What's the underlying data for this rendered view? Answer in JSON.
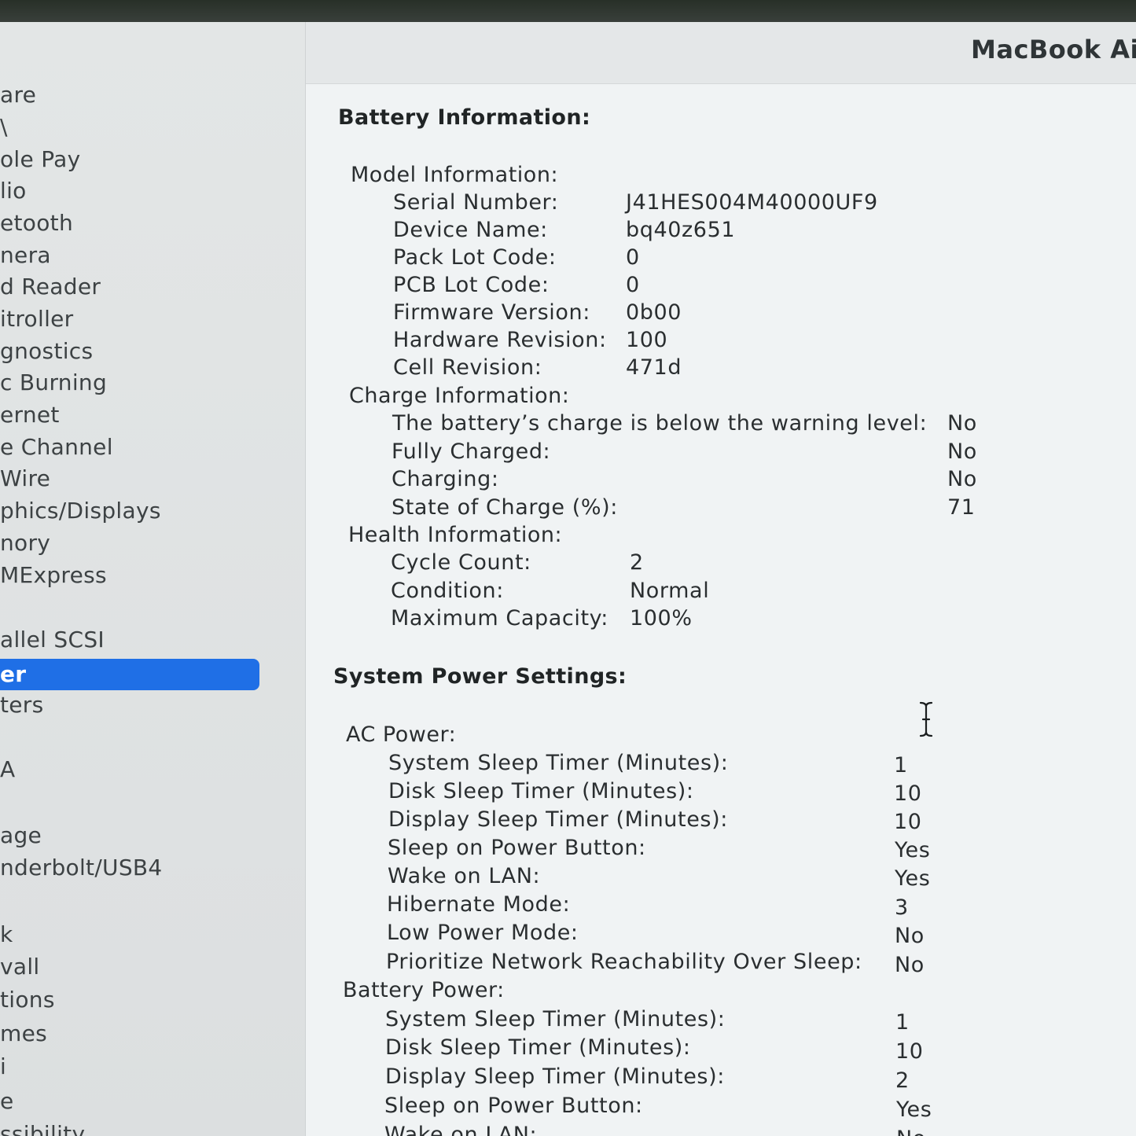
{
  "window": {
    "title": "MacBook Ai"
  },
  "sidebar": {
    "items": [
      {
        "label": "are"
      },
      {
        "label": "\\"
      },
      {
        "label": "ole Pay"
      },
      {
        "label": "lio"
      },
      {
        "label": "etooth"
      },
      {
        "label": "nera"
      },
      {
        "label": "d Reader"
      },
      {
        "label": "itroller"
      },
      {
        "label": "gnostics"
      },
      {
        "label": "c Burning"
      },
      {
        "label": "ernet"
      },
      {
        "label": "e Channel"
      },
      {
        "label": "Wire"
      },
      {
        "label": "phics/Displays"
      },
      {
        "label": "nory"
      },
      {
        "label": "MExpress"
      },
      {
        "label": "allel SCSI"
      },
      {
        "label": "er"
      },
      {
        "label": "ters"
      },
      {
        "label": "A"
      },
      {
        "label": "age"
      },
      {
        "label": "nderbolt/USB4"
      },
      {
        "label": "k"
      },
      {
        "label": "vall"
      },
      {
        "label": "tions"
      },
      {
        "label": "mes"
      },
      {
        "label": "i"
      },
      {
        "label": "e"
      },
      {
        "label": "ssibility"
      }
    ],
    "selected_index": 17,
    "selected_color": "#1f6fe6"
  },
  "battery": {
    "heading": "Battery Information:",
    "model": {
      "heading": "Model Information:",
      "rows": [
        {
          "label": "Serial Number:",
          "value": "J41HES004M40000UF9"
        },
        {
          "label": "Device Name:",
          "value": "bq40z651"
        },
        {
          "label": "Pack Lot Code:",
          "value": "0"
        },
        {
          "label": "PCB Lot Code:",
          "value": "0"
        },
        {
          "label": "Firmware Version:",
          "value": "0b00"
        },
        {
          "label": "Hardware Revision:",
          "value": "100"
        },
        {
          "label": "Cell Revision:",
          "value": "471d"
        }
      ]
    },
    "charge": {
      "heading": "Charge Information:",
      "rows": [
        {
          "label": "The battery’s charge is below the warning level:",
          "value": "No"
        },
        {
          "label": "Fully Charged:",
          "value": "No"
        },
        {
          "label": "Charging:",
          "value": "No"
        },
        {
          "label": "State of Charge (%):",
          "value": "71"
        }
      ]
    },
    "health": {
      "heading": "Health Information:",
      "rows": [
        {
          "label": "Cycle Count:",
          "value": "2"
        },
        {
          "label": "Condition:",
          "value": "Normal"
        },
        {
          "label": "Maximum Capacity:",
          "value": "100%"
        }
      ]
    }
  },
  "power": {
    "heading": "System Power Settings:",
    "ac": {
      "heading": "AC Power:",
      "rows": [
        {
          "label": "System Sleep Timer (Minutes):",
          "value": "1"
        },
        {
          "label": "Disk Sleep Timer (Minutes):",
          "value": "10"
        },
        {
          "label": "Display Sleep Timer (Minutes):",
          "value": "10"
        },
        {
          "label": "Sleep on Power Button:",
          "value": "Yes"
        },
        {
          "label": "Wake on LAN:",
          "value": "Yes"
        },
        {
          "label": "Hibernate Mode:",
          "value": "3"
        },
        {
          "label": "Low Power Mode:",
          "value": "No"
        },
        {
          "label": "Prioritize Network Reachability Over Sleep:",
          "value": "No"
        }
      ]
    },
    "battery_power": {
      "heading": "Battery Power:",
      "rows": [
        {
          "label": "System Sleep Timer (Minutes):",
          "value": "1"
        },
        {
          "label": "Disk Sleep Timer (Minutes):",
          "value": "10"
        },
        {
          "label": "Display Sleep Timer (Minutes):",
          "value": "2"
        },
        {
          "label": "Sleep on Power Button:",
          "value": "Yes"
        },
        {
          "label": "Wake on LAN:",
          "value": "No"
        }
      ]
    }
  },
  "icons": {
    "cursor": "text-cursor-icon"
  }
}
